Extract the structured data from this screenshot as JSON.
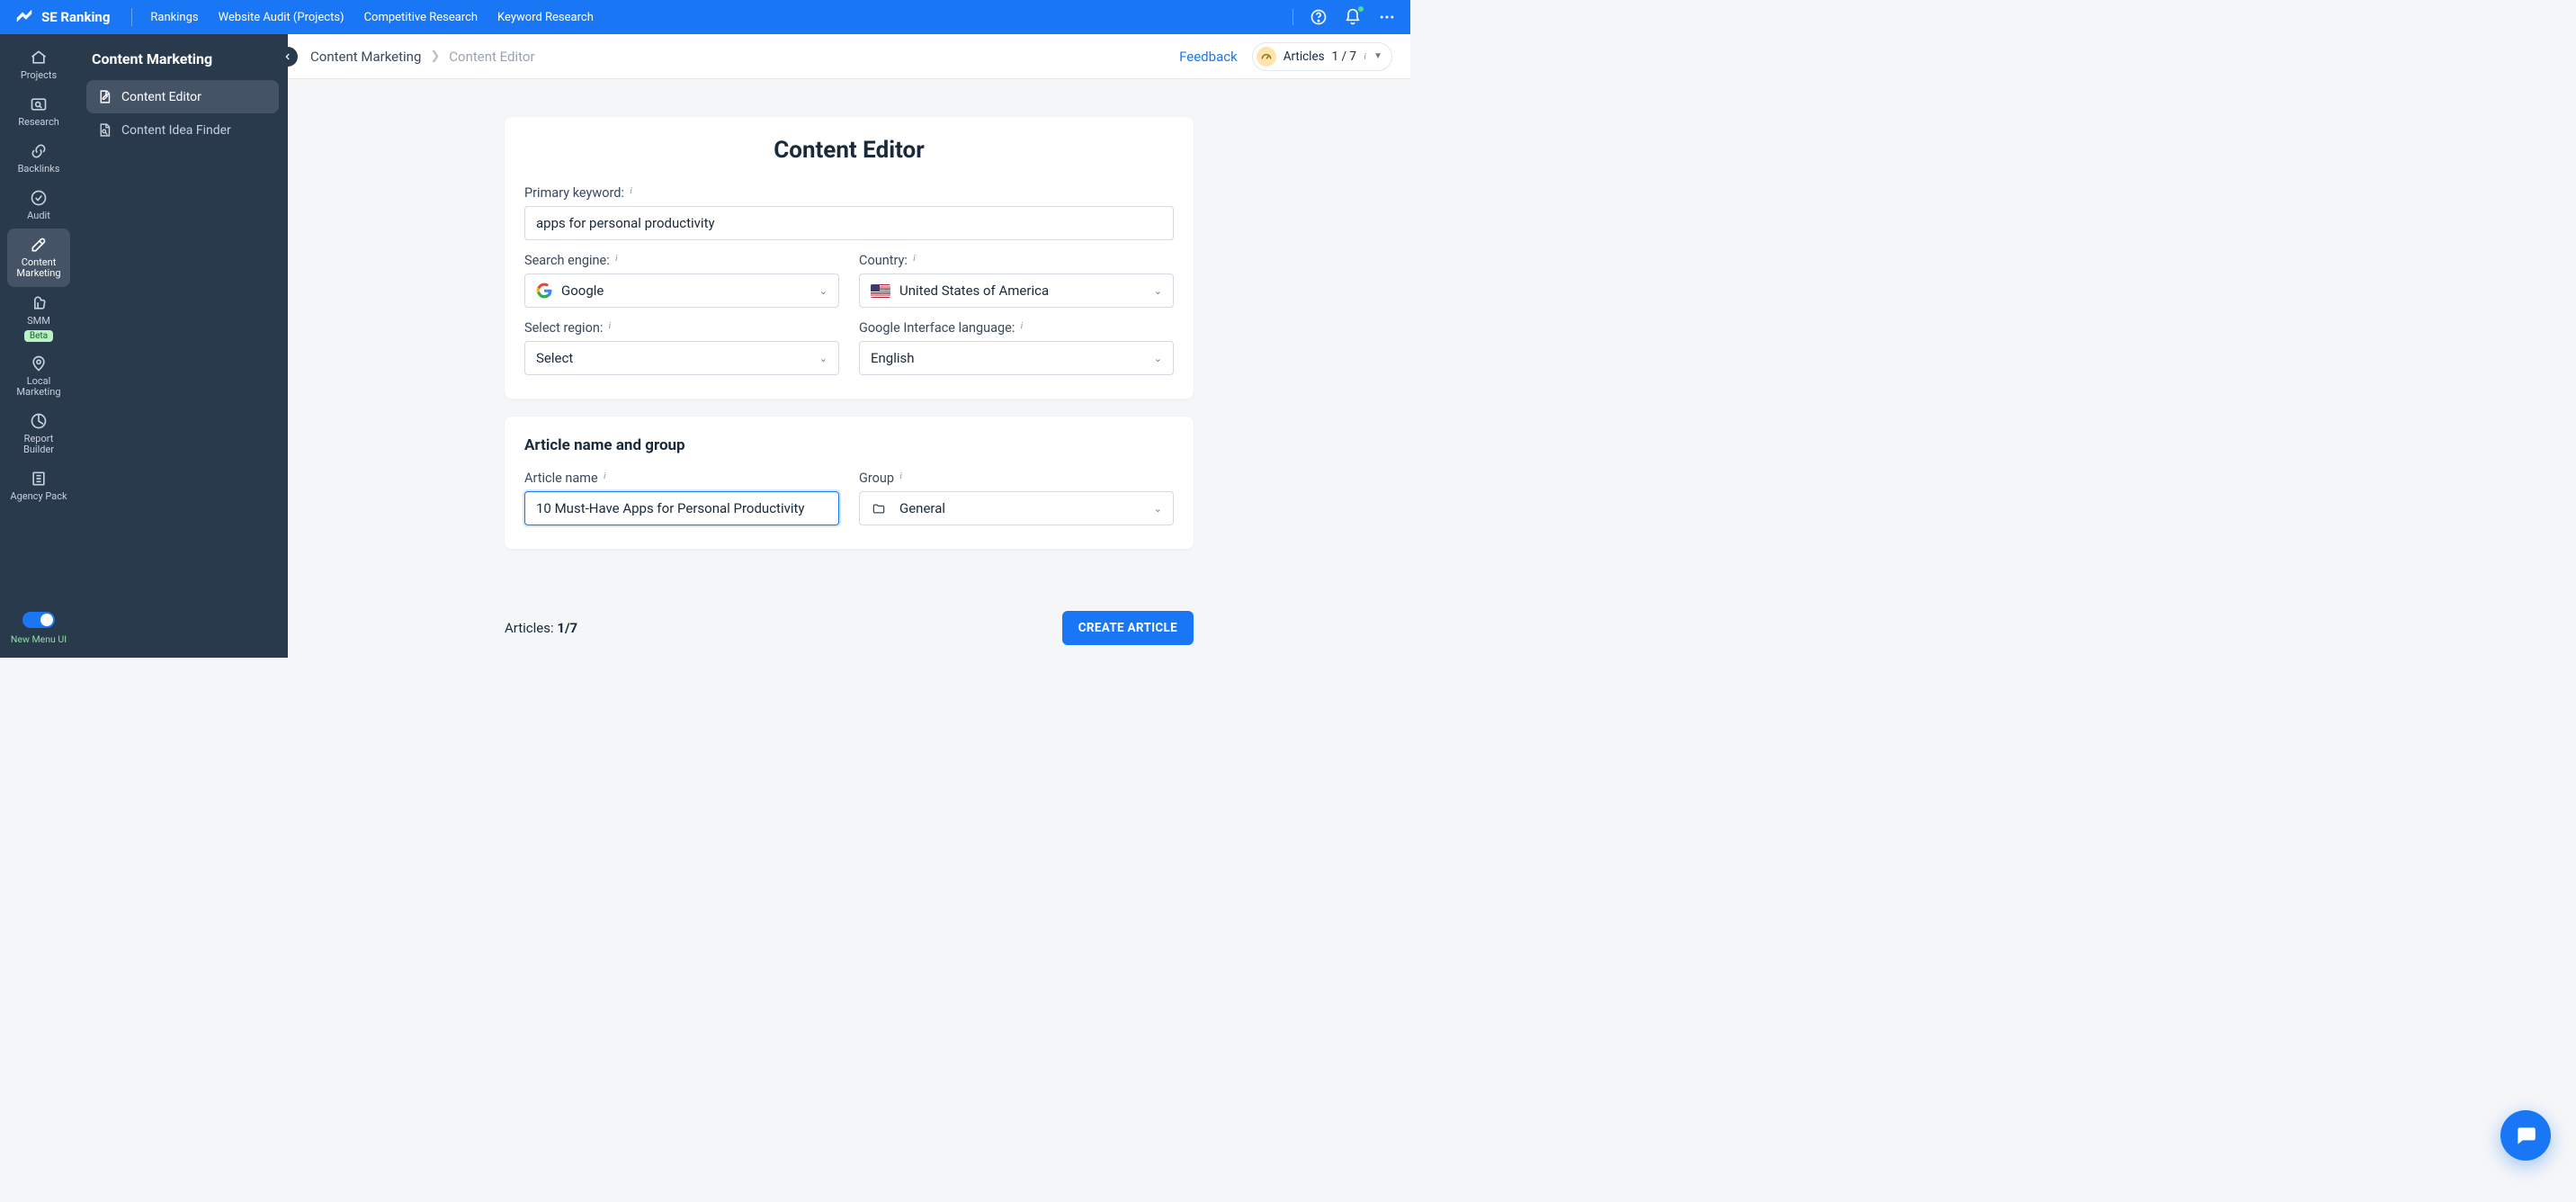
{
  "topbar": {
    "brand": "SE Ranking",
    "nav": [
      "Rankings",
      "Website Audit (Projects)",
      "Competitive Research",
      "Keyword Research"
    ]
  },
  "rail": {
    "items": [
      {
        "label": "Projects"
      },
      {
        "label": "Research"
      },
      {
        "label": "Backlinks"
      },
      {
        "label": "Audit"
      },
      {
        "label": "Content Marketing"
      },
      {
        "label": "SMM"
      },
      {
        "label": "Local Marketing"
      },
      {
        "label": "Report Builder"
      },
      {
        "label": "Agency Pack"
      }
    ],
    "beta": "Beta",
    "newui": "New Menu UI"
  },
  "subnav": {
    "title": "Content Marketing",
    "items": [
      "Content Editor",
      "Content Idea Finder"
    ]
  },
  "breadcrumb": {
    "a": "Content Marketing",
    "b": "Content Editor"
  },
  "head": {
    "feedback": "Feedback",
    "articles_label": "Articles",
    "articles_count": "1 / 7"
  },
  "card1": {
    "title": "Content Editor",
    "primary_keyword_label": "Primary keyword:",
    "primary_keyword_value": "apps for personal productivity",
    "search_engine_label": "Search engine:",
    "search_engine_value": "Google",
    "country_label": "Country:",
    "country_value": "United States of America",
    "region_label": "Select region:",
    "region_value": "Select",
    "lang_label": "Google Interface language:",
    "lang_value": "English"
  },
  "card2": {
    "title": "Article name and group",
    "name_label": "Article name",
    "name_value": "10 Must-Have Apps for Personal Productivity",
    "group_label": "Group",
    "group_value": "General"
  },
  "bottom": {
    "articles_label": "Articles: ",
    "articles_value": "1/7",
    "cta": "CREATE ARTICLE"
  }
}
